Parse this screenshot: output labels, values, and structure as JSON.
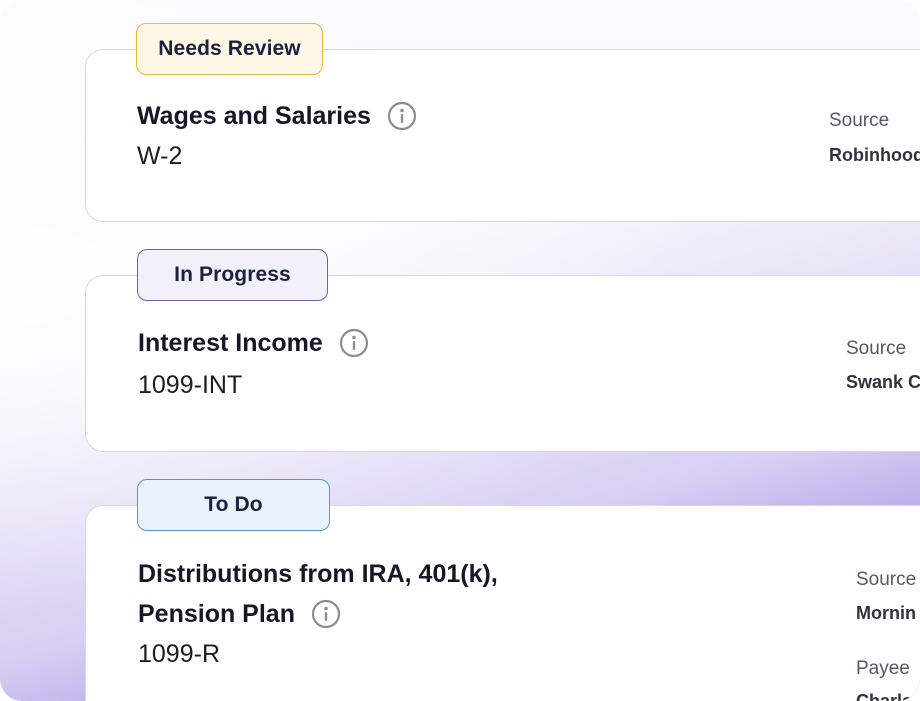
{
  "cards": [
    {
      "status": "Needs Review",
      "title": "Wages and Salaries",
      "form": "W-2",
      "source_label": "Source",
      "source_value": "Robinhood"
    },
    {
      "status": "In Progress",
      "title": "Interest Income",
      "form": "1099-INT",
      "source_label": "Source",
      "source_value": "Swank C"
    },
    {
      "status": "To Do",
      "title_line1": "Distributions from IRA, 401(k),",
      "title_line2": "Pension Plan",
      "form": "1099-R",
      "source_label": "Source",
      "source_value": "Mornin",
      "payee_label": "Payee",
      "payee_value": "Charle"
    }
  ],
  "colors": {
    "needs_review": "#efb63a",
    "in_progress": "#6b63a6",
    "to_do": "#4f97df",
    "gradient_accent": "#7860d6"
  },
  "icons": {
    "info": "info-circle-icon"
  }
}
